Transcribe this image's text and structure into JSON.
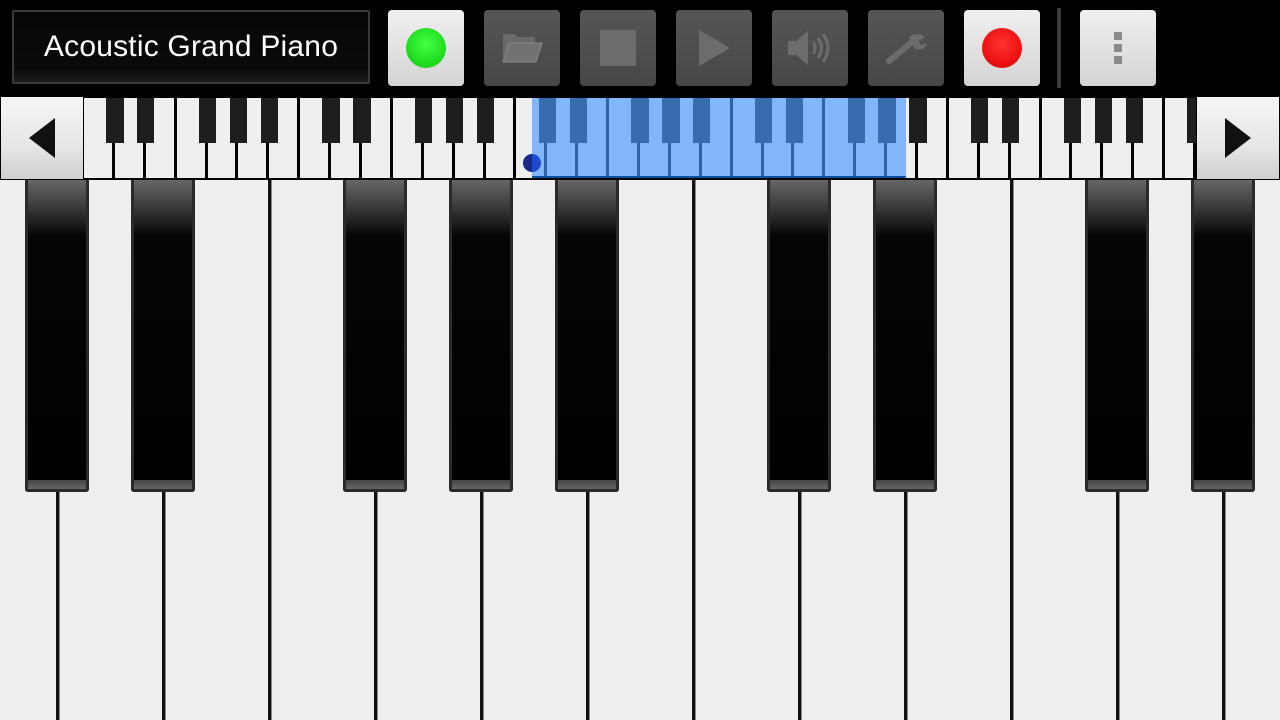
{
  "toolbar": {
    "instrument_name": "Acoustic Grand Piano",
    "buttons": [
      {
        "name": "instrument-status-button",
        "icon": "green-dot-icon",
        "enabled": true,
        "color": "#22dd22"
      },
      {
        "name": "open-file-button",
        "icon": "folder-icon",
        "enabled": false
      },
      {
        "name": "stop-button",
        "icon": "stop-icon",
        "enabled": false
      },
      {
        "name": "play-button",
        "icon": "play-icon",
        "enabled": false
      },
      {
        "name": "volume-button",
        "icon": "speaker-icon",
        "enabled": false
      },
      {
        "name": "settings-button",
        "icon": "wrench-icon",
        "enabled": false
      },
      {
        "name": "record-button",
        "icon": "record-icon",
        "enabled": true,
        "color": "#ee1111"
      },
      {
        "name": "overflow-menu-button",
        "icon": "vertical-dots-icon",
        "enabled": true
      }
    ]
  },
  "keyboard_navigator": {
    "scroll_left_icon": "left-arrow-icon",
    "scroll_right_icon": "right-arrow-icon",
    "first_note": "C",
    "white_keys_visible": 36,
    "selection_start_white_key": 14.5,
    "selection_white_key_count": 12.1,
    "highlight_color": "#4696ff"
  },
  "main_keyboard": {
    "first_visible_note": "C",
    "visible_notes": [
      "C",
      "D",
      "E",
      "F",
      "G",
      "A",
      "B",
      "C",
      "D",
      "E",
      "F",
      "G",
      "A"
    ]
  }
}
